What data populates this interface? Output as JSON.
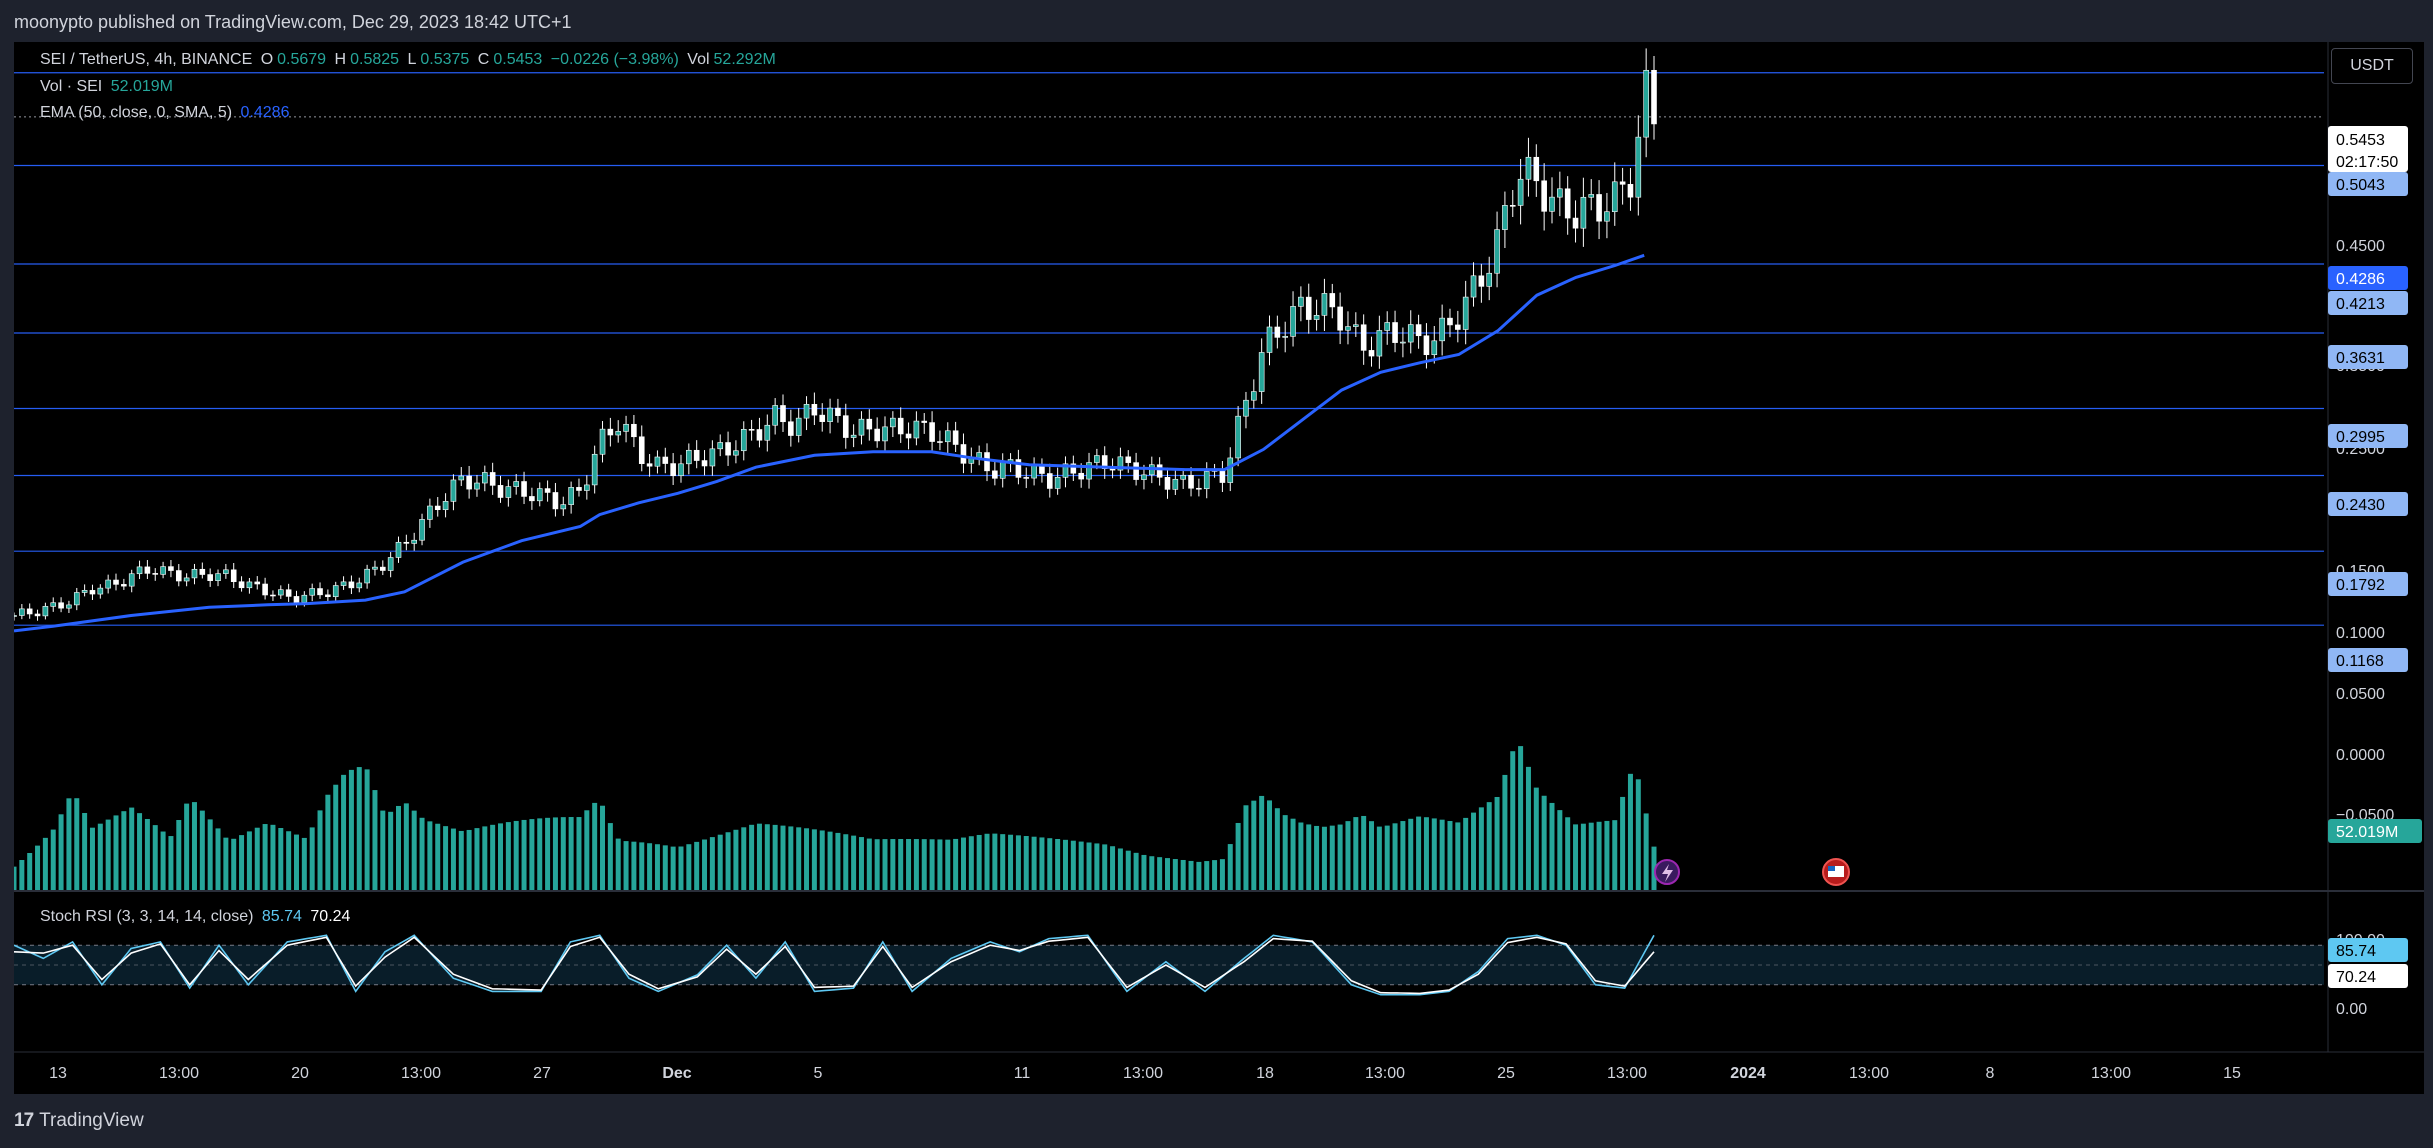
{
  "header": {
    "publisher": "moonypto published on TradingView.com, Dec 29, 2023 18:42 UTC+1"
  },
  "symbol": {
    "name": "SEI / TetherUS, 4h, BINANCE",
    "o_label": "O",
    "o": "0.5679",
    "h_label": "H",
    "h": "0.5825",
    "l_label": "L",
    "l": "0.5375",
    "c_label": "C",
    "c": "0.5453",
    "change": "−0.0226 (−3.98%)",
    "vol_label": "Vol",
    "vol": "52.292M"
  },
  "vol_legend": {
    "label": "Vol · SEI",
    "value": "52.019M"
  },
  "ema_legend": {
    "label": "EMA (50, close, 0, SMA, 5)",
    "value": "0.4286"
  },
  "stoch_legend": {
    "label": "Stoch RSI (3, 3, 14, 14, close)",
    "k": "85.74",
    "d": "70.24"
  },
  "currency_button": "USDT",
  "footer": {
    "logo_mark": "17",
    "logo_text": "TradingView"
  },
  "colors": {
    "up": "#26a69a",
    "down": "#ef5350",
    "candle": "#ffffff",
    "ema": "#2962ff",
    "volume": "#26a69a",
    "hline": "#2962ff",
    "stoch_k": "#5ec8f2",
    "stoch_d": "#ffffff"
  },
  "chart_data": {
    "type": "candlestick",
    "price_axis_ticks": [
      "0.4500",
      "0.3500",
      "0.2500",
      "0.2000",
      "0.1500",
      "0.1000",
      "0.0500",
      "0.0000",
      "−0.0500"
    ],
    "price_labels": [
      {
        "value": "0.5453",
        "countdown": "02:17:50",
        "kind": "last"
      },
      {
        "value": "0.5043",
        "kind": "level"
      },
      {
        "value": "0.4286",
        "kind": "ema"
      },
      {
        "value": "0.4213",
        "kind": "level"
      },
      {
        "value": "0.3631",
        "kind": "level"
      },
      {
        "value": "0.2995",
        "kind": "level"
      },
      {
        "value": "0.2430",
        "kind": "level"
      },
      {
        "value": "0.1792",
        "kind": "level"
      },
      {
        "value": "0.1168",
        "kind": "level"
      }
    ],
    "horizontal_levels": [
      0.5825,
      0.5043,
      0.4213,
      0.3631,
      0.2995,
      0.243,
      0.1792,
      0.1168
    ],
    "volume_label": "52.019M",
    "stoch_axis_ticks": [
      "100.00",
      "0.00"
    ],
    "stoch_labels": [
      {
        "value": "85.74",
        "kind": "k"
      },
      {
        "value": "70.24",
        "kind": "d"
      }
    ],
    "time_axis_ticks": [
      "13",
      "13:00",
      "20",
      "13:00",
      "27",
      "Dec",
      "5",
      "11",
      "13:00",
      "18",
      "13:00",
      "25",
      "13:00",
      "2024",
      "13:00",
      "8",
      "13:00",
      "15"
    ],
    "time_axis_ticks_bold": [
      "Dec",
      "2024"
    ],
    "close_path": [
      [
        0,
        0.125
      ],
      [
        10,
        0.128
      ],
      [
        20,
        0.132
      ],
      [
        30,
        0.138
      ],
      [
        40,
        0.148
      ],
      [
        50,
        0.15
      ],
      [
        60,
        0.158
      ],
      [
        70,
        0.165
      ],
      [
        80,
        0.16
      ],
      [
        90,
        0.158
      ],
      [
        100,
        0.16
      ],
      [
        110,
        0.158
      ],
      [
        120,
        0.15
      ],
      [
        130,
        0.146
      ],
      [
        140,
        0.14
      ],
      [
        150,
        0.142
      ],
      [
        160,
        0.145
      ],
      [
        170,
        0.15
      ],
      [
        180,
        0.158
      ],
      [
        190,
        0.17
      ],
      [
        200,
        0.185
      ],
      [
        210,
        0.205
      ],
      [
        220,
        0.225
      ],
      [
        230,
        0.24
      ],
      [
        240,
        0.238
      ],
      [
        250,
        0.232
      ],
      [
        260,
        0.23
      ],
      [
        270,
        0.226
      ],
      [
        280,
        0.22
      ],
      [
        290,
        0.23
      ],
      [
        300,
        0.27
      ],
      [
        310,
        0.29
      ],
      [
        320,
        0.262
      ],
      [
        330,
        0.25
      ],
      [
        340,
        0.252
      ],
      [
        350,
        0.258
      ],
      [
        360,
        0.262
      ],
      [
        370,
        0.27
      ],
      [
        380,
        0.28
      ],
      [
        390,
        0.292
      ],
      [
        400,
        0.285
      ],
      [
        410,
        0.3
      ],
      [
        420,
        0.29
      ],
      [
        430,
        0.28
      ],
      [
        440,
        0.282
      ],
      [
        450,
        0.282
      ],
      [
        460,
        0.283
      ],
      [
        470,
        0.28
      ],
      [
        480,
        0.27
      ],
      [
        490,
        0.258
      ],
      [
        500,
        0.248
      ],
      [
        510,
        0.25
      ],
      [
        520,
        0.245
      ],
      [
        530,
        0.24
      ],
      [
        540,
        0.245
      ],
      [
        550,
        0.25
      ],
      [
        560,
        0.255
      ],
      [
        570,
        0.25
      ],
      [
        580,
        0.245
      ],
      [
        590,
        0.24
      ],
      [
        600,
        0.235
      ],
      [
        610,
        0.24
      ],
      [
        620,
        0.245
      ],
      [
        630,
        0.3
      ],
      [
        640,
        0.35
      ],
      [
        650,
        0.37
      ],
      [
        660,
        0.385
      ],
      [
        670,
        0.385
      ],
      [
        680,
        0.378
      ],
      [
        690,
        0.35
      ],
      [
        700,
        0.36
      ],
      [
        710,
        0.365
      ],
      [
        720,
        0.355
      ],
      [
        730,
        0.36
      ],
      [
        740,
        0.38
      ],
      [
        750,
        0.405
      ],
      [
        760,
        0.44
      ],
      [
        770,
        0.5
      ],
      [
        780,
        0.49
      ],
      [
        790,
        0.47
      ],
      [
        800,
        0.465
      ],
      [
        810,
        0.47
      ],
      [
        820,
        0.475
      ],
      [
        830,
        0.5
      ],
      [
        835,
        0.57
      ],
      [
        840,
        0.545
      ]
    ],
    "ema_path": [
      [
        0,
        0.112
      ],
      [
        20,
        0.116
      ],
      [
        60,
        0.125
      ],
      [
        100,
        0.132
      ],
      [
        130,
        0.134
      ],
      [
        150,
        0.135
      ],
      [
        180,
        0.138
      ],
      [
        200,
        0.145
      ],
      [
        230,
        0.17
      ],
      [
        260,
        0.188
      ],
      [
        290,
        0.2
      ],
      [
        300,
        0.21
      ],
      [
        320,
        0.22
      ],
      [
        340,
        0.228
      ],
      [
        360,
        0.238
      ],
      [
        380,
        0.25
      ],
      [
        410,
        0.26
      ],
      [
        440,
        0.263
      ],
      [
        470,
        0.263
      ],
      [
        490,
        0.258
      ],
      [
        520,
        0.252
      ],
      [
        560,
        0.25
      ],
      [
        600,
        0.248
      ],
      [
        620,
        0.248
      ],
      [
        640,
        0.265
      ],
      [
        660,
        0.29
      ],
      [
        680,
        0.315
      ],
      [
        700,
        0.33
      ],
      [
        720,
        0.338
      ],
      [
        740,
        0.345
      ],
      [
        760,
        0.365
      ],
      [
        780,
        0.395
      ],
      [
        800,
        0.41
      ],
      [
        820,
        0.42
      ],
      [
        835,
        0.4286
      ]
    ],
    "volume_profile": [
      [
        0,
        0.25
      ],
      [
        20,
        0.55
      ],
      [
        30,
        0.85
      ],
      [
        40,
        0.5
      ],
      [
        60,
        0.6
      ],
      [
        80,
        0.35
      ],
      [
        90,
        0.6
      ],
      [
        110,
        0.3
      ],
      [
        130,
        0.4
      ],
      [
        150,
        0.3
      ],
      [
        160,
        0.55
      ],
      [
        170,
        0.7
      ],
      [
        180,
        0.75
      ],
      [
        190,
        0.45
      ],
      [
        200,
        0.55
      ],
      [
        210,
        0.45
      ],
      [
        230,
        0.4
      ],
      [
        250,
        0.5
      ],
      [
        290,
        0.7
      ],
      [
        300,
        0.95
      ],
      [
        310,
        0.5
      ],
      [
        320,
        0.45
      ],
      [
        340,
        0.35
      ],
      [
        360,
        0.4
      ],
      [
        380,
        0.45
      ],
      [
        400,
        0.4
      ],
      [
        420,
        0.35
      ],
      [
        440,
        0.3
      ],
      [
        460,
        0.3
      ],
      [
        480,
        0.3
      ],
      [
        500,
        0.35
      ],
      [
        520,
        0.35
      ],
      [
        540,
        0.35
      ],
      [
        560,
        0.35
      ],
      [
        580,
        0.3
      ],
      [
        600,
        0.3
      ],
      [
        620,
        0.3
      ],
      [
        630,
        0.75
      ],
      [
        640,
        0.8
      ],
      [
        650,
        0.6
      ],
      [
        660,
        0.5
      ],
      [
        670,
        0.45
      ],
      [
        680,
        0.45
      ],
      [
        690,
        0.5
      ],
      [
        700,
        0.4
      ],
      [
        720,
        0.45
      ],
      [
        740,
        0.4
      ],
      [
        760,
        0.55
      ],
      [
        770,
        0.9
      ],
      [
        780,
        0.6
      ],
      [
        790,
        0.5
      ],
      [
        800,
        0.4
      ],
      [
        820,
        0.45
      ],
      [
        830,
        0.85
      ],
      [
        840,
        0.3
      ]
    ],
    "stoch_k_path": [
      [
        0,
        0.8
      ],
      [
        15,
        0.6
      ],
      [
        30,
        0.85
      ],
      [
        45,
        0.2
      ],
      [
        60,
        0.75
      ],
      [
        75,
        0.85
      ],
      [
        90,
        0.15
      ],
      [
        105,
        0.8
      ],
      [
        120,
        0.2
      ],
      [
        140,
        0.85
      ],
      [
        160,
        0.95
      ],
      [
        175,
        0.1
      ],
      [
        190,
        0.7
      ],
      [
        205,
        0.95
      ],
      [
        225,
        0.3
      ],
      [
        245,
        0.1
      ],
      [
        270,
        0.1
      ],
      [
        285,
        0.85
      ],
      [
        300,
        0.95
      ],
      [
        315,
        0.3
      ],
      [
        330,
        0.1
      ],
      [
        350,
        0.35
      ],
      [
        365,
        0.8
      ],
      [
        380,
        0.3
      ],
      [
        395,
        0.85
      ],
      [
        410,
        0.1
      ],
      [
        430,
        0.15
      ],
      [
        445,
        0.85
      ],
      [
        460,
        0.1
      ],
      [
        480,
        0.6
      ],
      [
        500,
        0.85
      ],
      [
        515,
        0.7
      ],
      [
        530,
        0.9
      ],
      [
        550,
        0.95
      ],
      [
        570,
        0.1
      ],
      [
        590,
        0.55
      ],
      [
        610,
        0.1
      ],
      [
        630,
        0.6
      ],
      [
        645,
        0.95
      ],
      [
        665,
        0.85
      ],
      [
        685,
        0.2
      ],
      [
        700,
        0.05
      ],
      [
        720,
        0.05
      ],
      [
        735,
        0.1
      ],
      [
        750,
        0.4
      ],
      [
        765,
        0.9
      ],
      [
        780,
        0.95
      ],
      [
        795,
        0.8
      ],
      [
        810,
        0.2
      ],
      [
        825,
        0.15
      ],
      [
        840,
        0.95
      ]
    ],
    "stoch_d_path": [
      [
        0,
        0.7
      ],
      [
        15,
        0.68
      ],
      [
        30,
        0.8
      ],
      [
        45,
        0.28
      ],
      [
        60,
        0.68
      ],
      [
        75,
        0.82
      ],
      [
        90,
        0.2
      ],
      [
        105,
        0.72
      ],
      [
        120,
        0.28
      ],
      [
        140,
        0.8
      ],
      [
        160,
        0.92
      ],
      [
        175,
        0.18
      ],
      [
        190,
        0.62
      ],
      [
        205,
        0.92
      ],
      [
        225,
        0.36
      ],
      [
        245,
        0.14
      ],
      [
        270,
        0.12
      ],
      [
        285,
        0.78
      ],
      [
        300,
        0.92
      ],
      [
        315,
        0.36
      ],
      [
        330,
        0.14
      ],
      [
        350,
        0.32
      ],
      [
        365,
        0.74
      ],
      [
        380,
        0.36
      ],
      [
        395,
        0.78
      ],
      [
        410,
        0.16
      ],
      [
        430,
        0.18
      ],
      [
        445,
        0.78
      ],
      [
        460,
        0.16
      ],
      [
        480,
        0.55
      ],
      [
        500,
        0.8
      ],
      [
        515,
        0.72
      ],
      [
        530,
        0.86
      ],
      [
        550,
        0.92
      ],
      [
        570,
        0.16
      ],
      [
        590,
        0.5
      ],
      [
        610,
        0.16
      ],
      [
        630,
        0.55
      ],
      [
        645,
        0.9
      ],
      [
        665,
        0.86
      ],
      [
        685,
        0.26
      ],
      [
        700,
        0.08
      ],
      [
        720,
        0.07
      ],
      [
        735,
        0.12
      ],
      [
        750,
        0.36
      ],
      [
        765,
        0.84
      ],
      [
        780,
        0.92
      ],
      [
        795,
        0.82
      ],
      [
        810,
        0.26
      ],
      [
        825,
        0.18
      ],
      [
        840,
        0.7
      ]
    ]
  }
}
